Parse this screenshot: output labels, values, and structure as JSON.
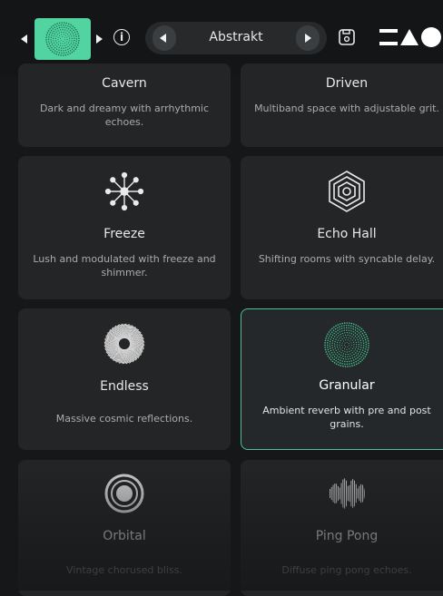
{
  "toolbar": {
    "preset_name": "Abstrakt"
  },
  "colors": {
    "accent": "#52d4a0",
    "selected_border": "#4fbf95",
    "card_bg": "#232527"
  },
  "cards": [
    {
      "title": "Cavern",
      "desc": "Dark and dreamy with arrhythmic echoes.",
      "icon": "cavern-icon"
    },
    {
      "title": "Driven",
      "desc": "Multiband space with adjustable grit.",
      "icon": "driven-icon"
    },
    {
      "title": "Freeze",
      "desc": "Lush and modulated with freeze and shimmer.",
      "icon": "snowflake-icon"
    },
    {
      "title": "Echo Hall",
      "desc": "Shifting rooms with syncable delay.",
      "icon": "hexagon-icon"
    },
    {
      "title": "Endless",
      "desc": "Massive cosmic reflections.",
      "icon": "spiral-icon"
    },
    {
      "title": "Granular",
      "desc": "Ambient reverb with pre and post grains.",
      "icon": "dotted-sphere-icon",
      "selected": true
    },
    {
      "title": "Orbital",
      "desc": "Vintage chorused bliss.",
      "icon": "rings-icon"
    },
    {
      "title": "Ping Pong",
      "desc": "Diffuse ping pong echoes.",
      "icon": "waveform-icon"
    }
  ]
}
